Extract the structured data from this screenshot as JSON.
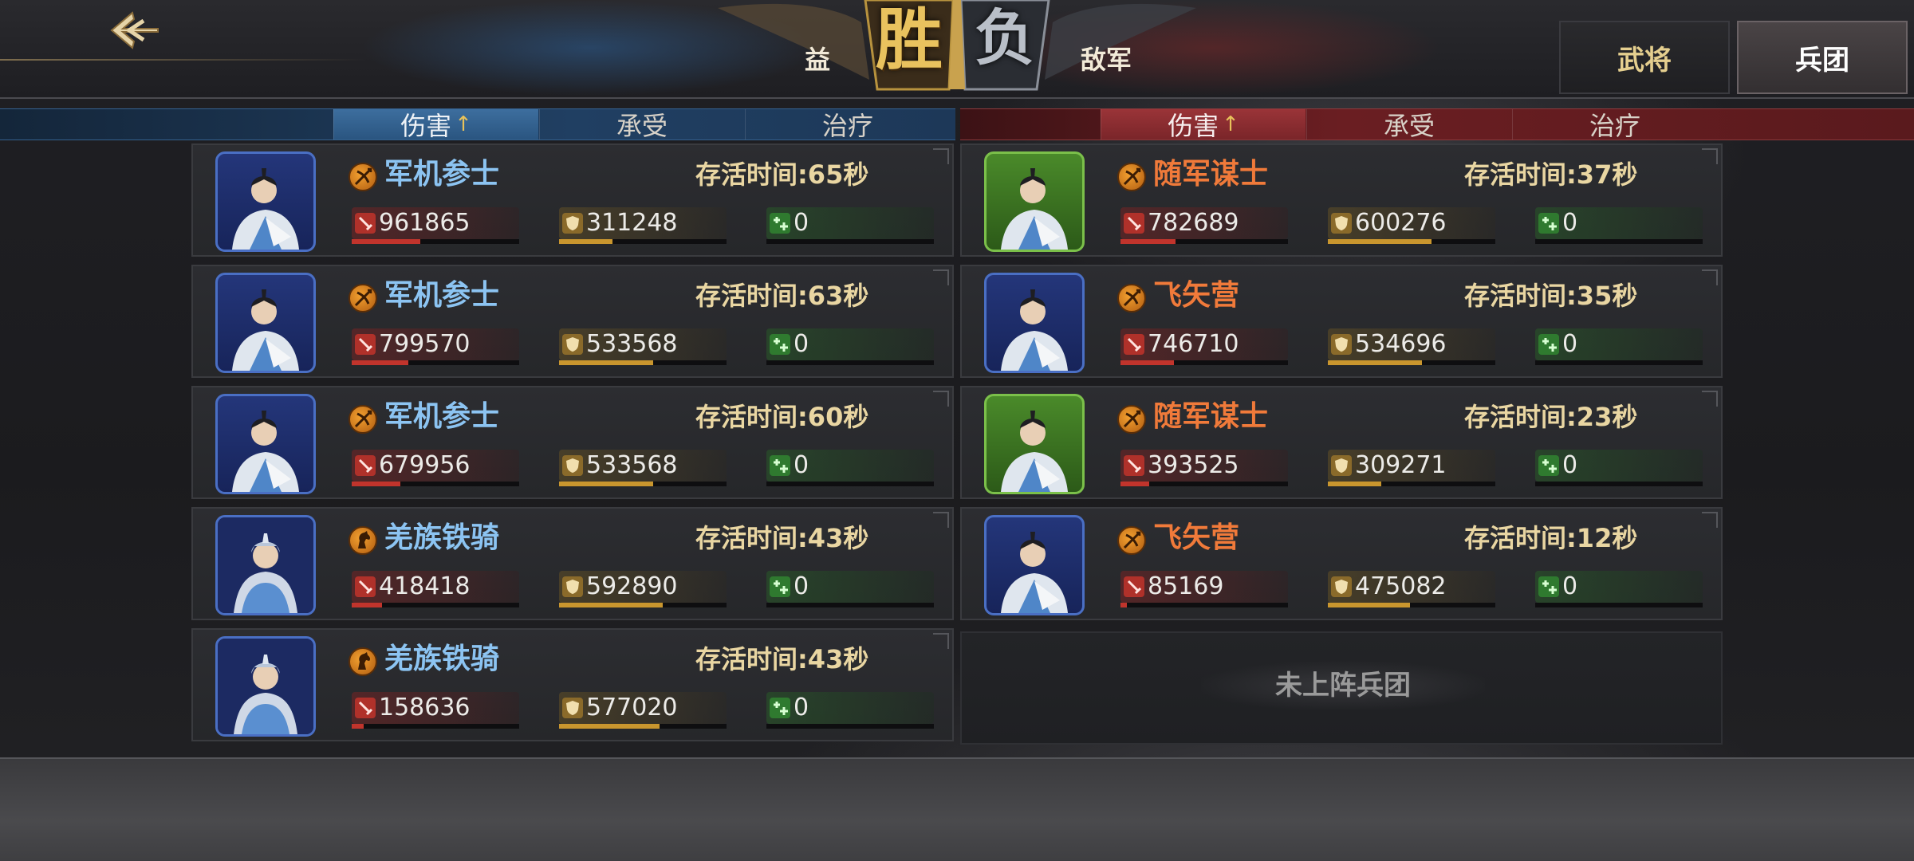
{
  "header": {
    "our_side": "益",
    "enemy_side": "敌军",
    "result_win": "胜",
    "result_lose": "负",
    "toggles": [
      "武将",
      "兵团"
    ]
  },
  "columns": {
    "damage": "伤害",
    "taken": "承受",
    "heal": "治疗",
    "sort_indicator": "↑"
  },
  "left_rows": [
    {
      "icon": "crossbow-icon",
      "name": "军机参士",
      "survival": "存活时间:65秒",
      "damage": "961865",
      "taken": "311248",
      "heal": "0",
      "damage_pct": 0.41,
      "taken_pct": 0.32,
      "heal_pct": 0
    },
    {
      "icon": "crossbow-icon",
      "name": "军机参士",
      "survival": "存活时间:63秒",
      "damage": "799570",
      "taken": "533568",
      "heal": "0",
      "damage_pct": 0.34,
      "taken_pct": 0.56,
      "heal_pct": 0
    },
    {
      "icon": "crossbow-icon",
      "name": "军机参士",
      "survival": "存活时间:60秒",
      "damage": "679956",
      "taken": "533568",
      "heal": "0",
      "damage_pct": 0.29,
      "taken_pct": 0.56,
      "heal_pct": 0
    },
    {
      "icon": "horse-icon",
      "name": "羌族铁骑",
      "survival": "存活时间:43秒",
      "damage": "418418",
      "taken": "592890",
      "heal": "0",
      "damage_pct": 0.18,
      "taken_pct": 0.62,
      "heal_pct": 0
    },
    {
      "icon": "horse-icon",
      "name": "羌族铁骑",
      "survival": "存活时间:43秒",
      "damage": "158636",
      "taken": "577020",
      "heal": "0",
      "damage_pct": 0.07,
      "taken_pct": 0.6,
      "heal_pct": 0
    }
  ],
  "right_rows": [
    {
      "icon": "crossbow-icon",
      "name": "随军谋士",
      "survival": "存活时间:37秒",
      "damage": "782689",
      "taken": "600276",
      "heal": "0",
      "damage_pct": 0.33,
      "taken_pct": 0.62,
      "heal_pct": 0
    },
    {
      "icon": "crossbow-icon",
      "name": "飞矢营",
      "survival": "存活时间:35秒",
      "damage": "746710",
      "taken": "534696",
      "heal": "0",
      "damage_pct": 0.32,
      "taken_pct": 0.56,
      "heal_pct": 0
    },
    {
      "icon": "crossbow-icon",
      "name": "随军谋士",
      "survival": "存活时间:23秒",
      "damage": "393525",
      "taken": "309271",
      "heal": "0",
      "damage_pct": 0.17,
      "taken_pct": 0.32,
      "heal_pct": 0
    },
    {
      "icon": "crossbow-icon",
      "name": "飞矢营",
      "survival": "存活时间:12秒",
      "damage": "85169",
      "taken": "475082",
      "heal": "0",
      "damage_pct": 0.04,
      "taken_pct": 0.49,
      "heal_pct": 0
    }
  ],
  "empty_slot": "未上阵兵团",
  "colors": {
    "our_accent": "#2a5580",
    "enemy_accent": "#7a2529",
    "win_gold": "#e9c25e",
    "damage_bar": "#c1342c",
    "taken_bar": "#c9962e",
    "heal_bar": "#3d9a3d"
  }
}
